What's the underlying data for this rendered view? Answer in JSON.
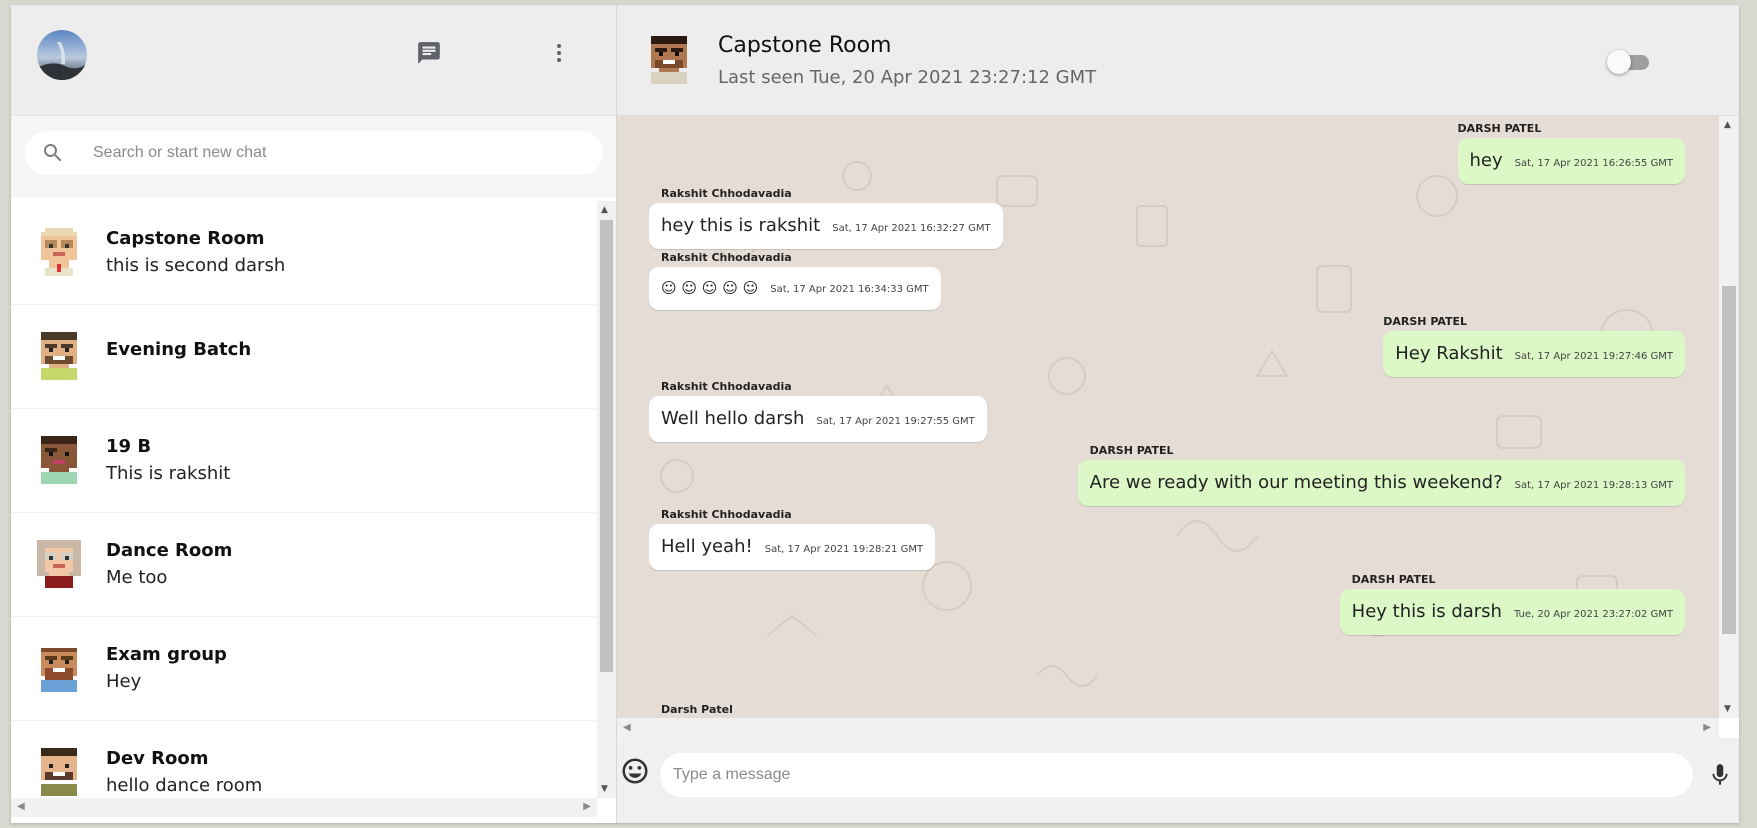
{
  "sidebar": {
    "search_placeholder": "Search or start new chat",
    "chats": [
      {
        "name": "Capstone Room",
        "last": "this is second darsh"
      },
      {
        "name": "Evening Batch",
        "last": ""
      },
      {
        "name": "19 B",
        "last": "This is rakshit"
      },
      {
        "name": "Dance Room",
        "last": "Me too"
      },
      {
        "name": "Exam group",
        "last": "Hey"
      },
      {
        "name": "Dev Room",
        "last": "hello dance room"
      }
    ]
  },
  "chat": {
    "title": "Capstone Room",
    "status": "Last seen Tue, 20 Apr 2021 23:27:12 GMT",
    "messages": [
      {
        "dir": "out",
        "sender": "DARSH PATEL",
        "text": "hey",
        "time": "Sat, 17 Apr 2021 16:26:55 GMT"
      },
      {
        "dir": "in",
        "sender": "Rakshit Chhodavadia",
        "text": "hey this is rakshit",
        "time": "Sat, 17 Apr 2021 16:32:27 GMT"
      },
      {
        "dir": "in",
        "sender": "Rakshit Chhodavadia",
        "text": "☺ ☺ ☺ ☺ ☺",
        "time": "Sat, 17 Apr 2021 16:34:33 GMT"
      },
      {
        "dir": "out",
        "sender": "DARSH PATEL",
        "text": "Hey Rakshit",
        "time": "Sat, 17 Apr 2021 19:27:46 GMT"
      },
      {
        "dir": "in",
        "sender": "Rakshit Chhodavadia",
        "text": "Well hello darsh",
        "time": "Sat, 17 Apr 2021 19:27:55 GMT"
      },
      {
        "dir": "out",
        "sender": "DARSH PATEL",
        "text": "Are we ready with our meeting this weekend?",
        "time": "Sat, 17 Apr 2021 19:28:13 GMT"
      },
      {
        "dir": "in",
        "sender": "Rakshit Chhodavadia",
        "text": "Hell yeah!",
        "time": "Sat, 17 Apr 2021 19:28:21 GMT"
      },
      {
        "dir": "out",
        "sender": "DARSH PATEL",
        "text": "Hey this is darsh",
        "time": "Tue, 20 Apr 2021 23:27:02 GMT"
      },
      {
        "dir": "in",
        "sender": "Darsh Patel",
        "text": "",
        "time": ""
      }
    ],
    "composer_placeholder": "Type a message"
  },
  "icons": {
    "new_chat": "chat-icon",
    "menu": "more-vert-icon",
    "search": "search-icon",
    "emoji": "emoji-icon",
    "mic": "mic-icon"
  },
  "colors": {
    "outgoing_bubble": "#dcf8c6",
    "incoming_bubble": "#ffffff",
    "chat_background": "#e5ddd5",
    "header_background": "#ededed"
  }
}
